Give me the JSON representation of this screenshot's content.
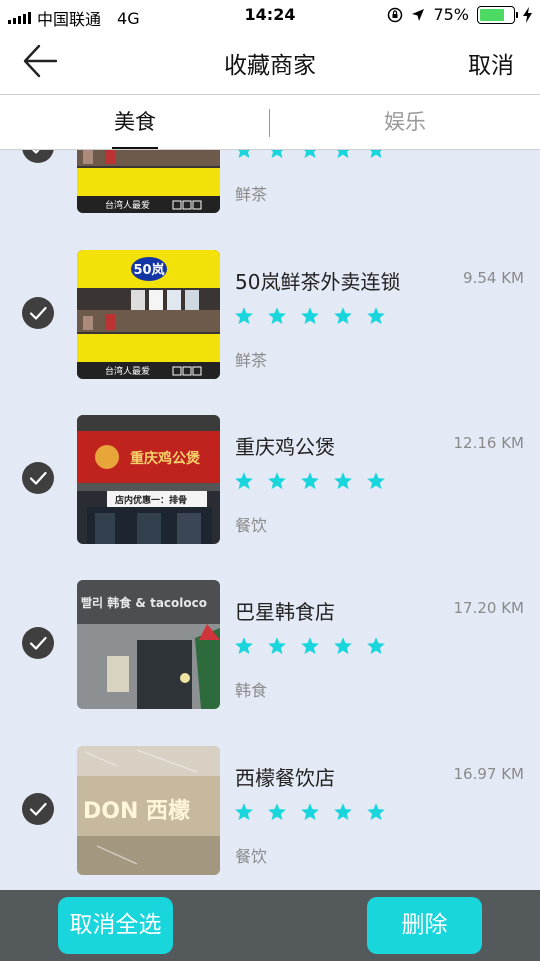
{
  "status_bar": {
    "carrier": "中国联通",
    "network": "4G",
    "time": "14:24",
    "battery_percent": "75%",
    "battery_level": 0.75
  },
  "nav": {
    "title": "收藏商家",
    "cancel_label": "取消",
    "back_icon": "arrow-left-icon"
  },
  "tabs": [
    {
      "label": "美食",
      "active": true
    },
    {
      "label": "娱乐",
      "active": false
    }
  ],
  "list": {
    "items": [
      {
        "name": "",
        "distance": "",
        "category": "鲜茶",
        "rating": 5,
        "checked": true,
        "thumb": "yellow-shop-sign"
      },
      {
        "name": "50岚鲜茶外卖连锁",
        "distance": "9.54 KM",
        "category": "鲜茶",
        "rating": 5,
        "checked": true,
        "thumb": "yellow-shop-sign"
      },
      {
        "name": "重庆鸡公煲",
        "distance": "12.16 KM",
        "category": "餐饮",
        "rating": 5,
        "checked": true,
        "thumb": "red-shop-sign"
      },
      {
        "name": "巴星韩食店",
        "distance": "17.20 KM",
        "category": "韩食",
        "rating": 5,
        "checked": true,
        "thumb": "grey-shop-sign"
      },
      {
        "name": "西檬餐饮店",
        "distance": "16.97 KM",
        "category": "餐饮",
        "rating": 5,
        "checked": true,
        "thumb": "glass-shop-sign"
      }
    ],
    "star_color": "#19d6dc"
  },
  "bottom_bar": {
    "unselect_all_label": "取消全选",
    "delete_label": "删除",
    "button_color": "#19d6dc"
  },
  "thumb_text": {
    "yellow_sign": "50岚",
    "yellow_caption": "台湾人最爱",
    "red_sign": "重庆鸡公煲",
    "red_strip": "店内优惠一：排骨",
    "grey_sign": "빨리 韩食 & tacoloco",
    "glass_sign": "DON 西檬"
  }
}
